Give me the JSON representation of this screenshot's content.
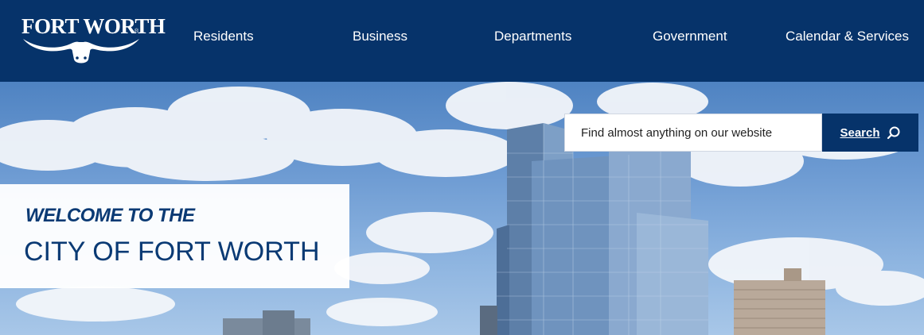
{
  "header": {
    "logo_text": "FORT WORTH",
    "logo_reg": "®",
    "nav": [
      {
        "label": "Residents"
      },
      {
        "label": "Business"
      },
      {
        "label": "Departments"
      },
      {
        "label": "Government"
      },
      {
        "label": "Calendar & Services"
      }
    ]
  },
  "search": {
    "placeholder": "Find almost anything on our website",
    "button_label": "Search"
  },
  "hero": {
    "welcome_line1": "WELCOME TO THE",
    "welcome_line2": "CITY OF FORT WORTH"
  },
  "colors": {
    "brand_navy": "#06336a",
    "headline": "#0a3a74"
  }
}
